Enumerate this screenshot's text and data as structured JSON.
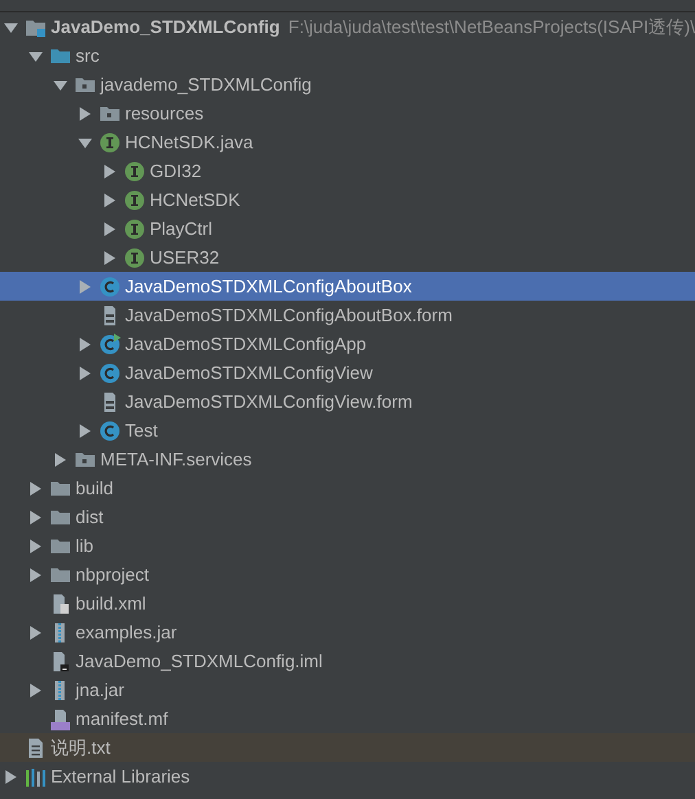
{
  "tree": [
    {
      "kind": "project",
      "label": "JavaDemo_STDXMLConfig",
      "path": "F:\\juda\\juda\\test\\test\\NetBeansProjects(ISAPI透传)\\",
      "expanded": true,
      "selected": false,
      "children": [
        {
          "kind": "source-folder",
          "label": "src",
          "expanded": true,
          "selected": false,
          "children": [
            {
              "kind": "package",
              "label": "javademo_STDXMLConfig",
              "expanded": true,
              "selected": false,
              "children": [
                {
                  "kind": "package",
                  "label": "resources",
                  "expanded": false,
                  "selected": false
                },
                {
                  "kind": "interface",
                  "label": "HCNetSDK.java",
                  "expanded": true,
                  "selected": false,
                  "children": [
                    {
                      "kind": "interface",
                      "label": "GDI32",
                      "expanded": false,
                      "selected": false
                    },
                    {
                      "kind": "interface",
                      "label": "HCNetSDK",
                      "expanded": false,
                      "selected": false
                    },
                    {
                      "kind": "interface",
                      "label": "PlayCtrl",
                      "expanded": false,
                      "selected": false
                    },
                    {
                      "kind": "interface",
                      "label": "USER32",
                      "expanded": false,
                      "selected": false
                    }
                  ]
                },
                {
                  "kind": "class",
                  "label": "JavaDemoSTDXMLConfigAboutBox",
                  "expanded": false,
                  "selected": true
                },
                {
                  "kind": "form",
                  "label": "JavaDemoSTDXMLConfigAboutBox.form",
                  "selected": false
                },
                {
                  "kind": "main-class",
                  "label": "JavaDemoSTDXMLConfigApp",
                  "expanded": false,
                  "selected": false
                },
                {
                  "kind": "class",
                  "label": "JavaDemoSTDXMLConfigView",
                  "expanded": false,
                  "selected": false
                },
                {
                  "kind": "form",
                  "label": "JavaDemoSTDXMLConfigView.form",
                  "selected": false
                },
                {
                  "kind": "class",
                  "label": "Test",
                  "expanded": false,
                  "selected": false
                }
              ]
            },
            {
              "kind": "package",
              "label": "META-INF.services",
              "expanded": false,
              "selected": false
            }
          ]
        },
        {
          "kind": "folder",
          "label": "build",
          "expanded": false,
          "selected": false
        },
        {
          "kind": "folder",
          "label": "dist",
          "expanded": false,
          "selected": false
        },
        {
          "kind": "folder",
          "label": "lib",
          "expanded": false,
          "selected": false
        },
        {
          "kind": "folder",
          "label": "nbproject",
          "expanded": false,
          "selected": false
        },
        {
          "kind": "xml",
          "label": "build.xml",
          "selected": false
        },
        {
          "kind": "jar",
          "label": "examples.jar",
          "expanded": false,
          "selected": false
        },
        {
          "kind": "iml",
          "label": "JavaDemo_STDXMLConfig.iml",
          "selected": false
        },
        {
          "kind": "jar",
          "label": "jna.jar",
          "expanded": false,
          "selected": false
        },
        {
          "kind": "manifest",
          "label": "manifest.mf",
          "selected": false
        }
      ]
    },
    {
      "kind": "text",
      "label": "说明.txt",
      "selected": false,
      "color": "#45413a"
    },
    {
      "kind": "libraries",
      "label": "External Libraries",
      "expanded": false,
      "selected": false
    }
  ]
}
